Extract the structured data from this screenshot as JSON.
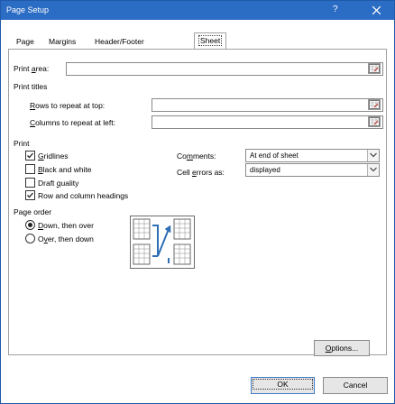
{
  "window": {
    "title": "Page Setup",
    "help": "?"
  },
  "tabs": [
    {
      "label": "Page"
    },
    {
      "label": "Margins"
    },
    {
      "label": "Header/Footer"
    },
    {
      "label": "Sheet"
    }
  ],
  "print_area": {
    "label_pre": "Print ",
    "label_key": "a",
    "label_post": "rea:",
    "value": ""
  },
  "print_titles": {
    "heading": "Print titles",
    "rows": {
      "label_key": "R",
      "label_post": "ows to repeat at top:",
      "value": ""
    },
    "columns": {
      "label_key": "C",
      "label_post": "olumns to repeat at left:",
      "value": ""
    }
  },
  "print": {
    "heading": "Print",
    "gridlines": {
      "label_key": "G",
      "label_post": "ridlines",
      "checked": true
    },
    "black_white": {
      "label_key": "B",
      "label_post": "lack and white",
      "checked": false
    },
    "draft": {
      "label_pre": "Draft ",
      "label_key": "q",
      "label_post": "uality",
      "checked": false
    },
    "headings": {
      "label": "Row and column headings",
      "checked": true
    },
    "comments": {
      "label_pre": "Co",
      "label_key": "m",
      "label_post": "ments:",
      "value": "At end of sheet"
    },
    "cell_errors": {
      "label_pre": "Cell ",
      "label_key": "e",
      "label_post": "rrors as:",
      "value": "displayed"
    }
  },
  "page_order": {
    "heading": "Page order",
    "down_over": {
      "label_key": "D",
      "label_post": "own, then over",
      "selected": true
    },
    "over_down": {
      "label_pre": "O",
      "label_key": "v",
      "label_post": "er, then down",
      "selected": false
    }
  },
  "buttons": {
    "options": {
      "label_key": "O",
      "label_post": "ptions..."
    },
    "ok": "OK",
    "cancel": "Cancel"
  },
  "colors": {
    "titlebar": "#2b6cc4",
    "focus": "#3f7cc9"
  }
}
